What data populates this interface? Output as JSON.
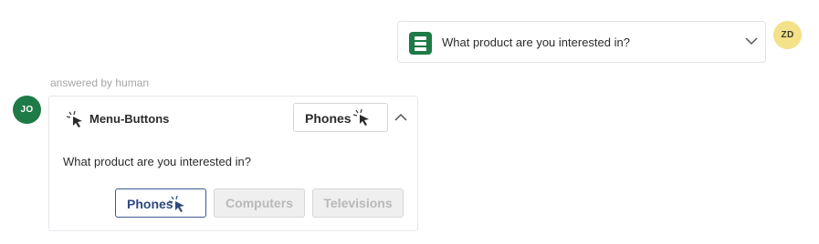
{
  "user_message": {
    "text": "What product are you interested in?",
    "avatar_initials": "ZD",
    "avatar_color": "#f3e28a",
    "icon": "list-icon",
    "expand_icon": "chevron-down-icon"
  },
  "answered_label": "answered by human",
  "bot_message": {
    "avatar_initials": "JO",
    "avatar_color": "#1e7a46",
    "type_icon": "cursor-click-icon",
    "title": "Menu-Buttons",
    "selected_value": "Phones",
    "collapse_icon": "chevron-up-icon",
    "question": "What product are you interested in?",
    "options": [
      {
        "label": "Phones",
        "state": "selected"
      },
      {
        "label": "Computers",
        "state": "disabled"
      },
      {
        "label": "Televisions",
        "state": "disabled"
      }
    ]
  },
  "colors": {
    "accent_green": "#1e7a46",
    "selected_border": "#3b5a8f",
    "disabled_bg": "#efefef"
  }
}
